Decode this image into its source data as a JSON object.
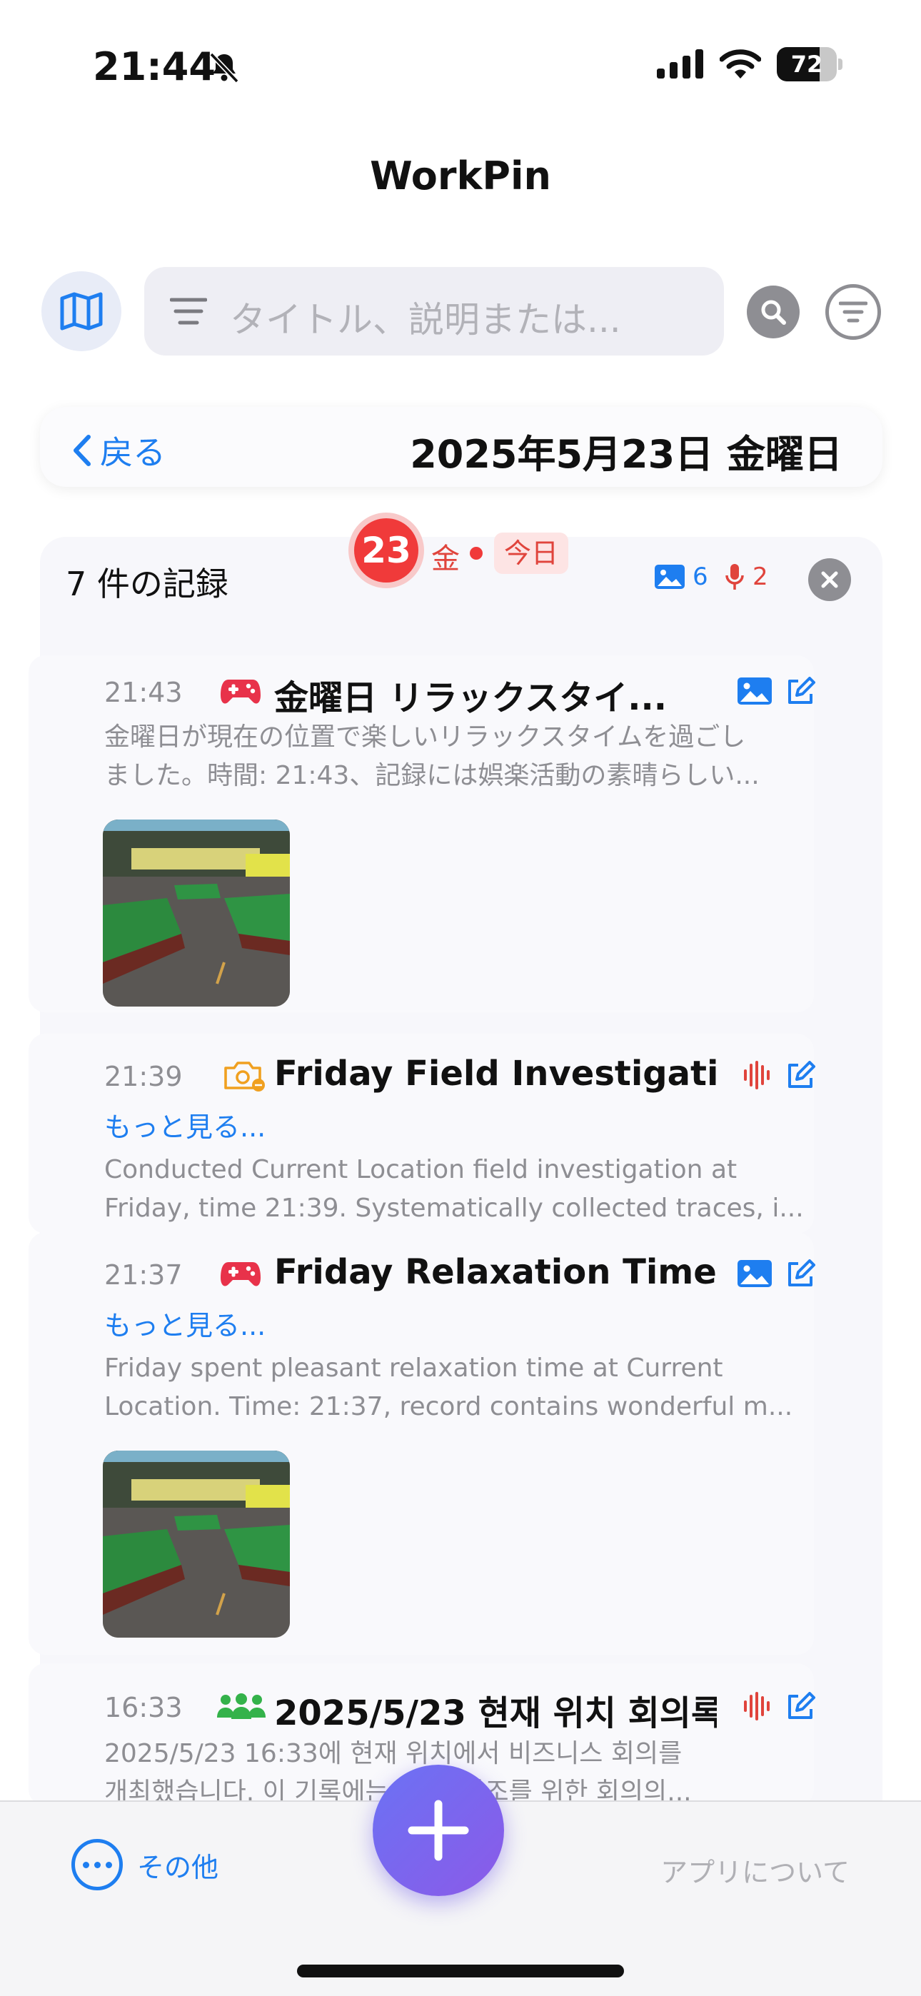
{
  "status_bar": {
    "time": "21:44",
    "battery": "72",
    "battery_level": 0.72
  },
  "app": {
    "title": "WorkPin"
  },
  "search": {
    "placeholder": "タイトル、説明または..."
  },
  "date_header": {
    "back_label": "戻る",
    "date": "2025年5月23日 金曜日"
  },
  "day_badge": {
    "day": "23",
    "weekday": "金",
    "today_label": "今日"
  },
  "records_panel": {
    "count_label": "7 件の記録",
    "image_count": "6",
    "audio_count": "2"
  },
  "records": [
    {
      "time": "21:43",
      "category_icon": "gamepad-icon",
      "title": "金曜日 リラックスタイ...",
      "action_icon": "image-icon",
      "more": "",
      "desc_line1": "金曜日が現在の位置で楽しいリラックスタイムを過ごし",
      "desc_line2": "ました。時間: 21:43、記録には娯楽活動の素晴らしい...",
      "has_photo": true
    },
    {
      "time": "21:39",
      "category_icon": "camera-icon",
      "title": "Friday Field Investigatio...",
      "action_icon": "audio-wave-icon",
      "more": "もっと見る...",
      "desc_line1": "Conducted Current Location field investigation at",
      "desc_line2": "Friday, time 21:39. Systematically collected traces, i...",
      "has_photo": false
    },
    {
      "time": "21:37",
      "category_icon": "gamepad-icon",
      "title": "Friday Relaxation Time...",
      "action_icon": "image-icon",
      "more": "もっと見る...",
      "desc_line1": "Friday spent pleasant relaxation time at Current",
      "desc_line2": "Location. Time: 21:37, record contains wonderful m...",
      "has_photo": true
    },
    {
      "time": "16:33",
      "category_icon": "people-icon",
      "title": "2025/5/23 현재 위치 회의록",
      "action_icon": "audio-wave-icon",
      "more": "",
      "desc_line1": "2025/5/23 16:33에 현재 위치에서 비즈니스 회의를",
      "desc_line2": "개최했습니다. 이 기록에는 ... 및 참조를 위한 회의의...",
      "has_photo": false
    }
  ],
  "bottom_bar": {
    "more_label": "その他",
    "about_label": "アプリについて"
  },
  "colors": {
    "accent": "#1e7ef0",
    "red": "#f03a3a",
    "fab_start": "#6b72f4",
    "fab_end": "#8b5ae8"
  }
}
